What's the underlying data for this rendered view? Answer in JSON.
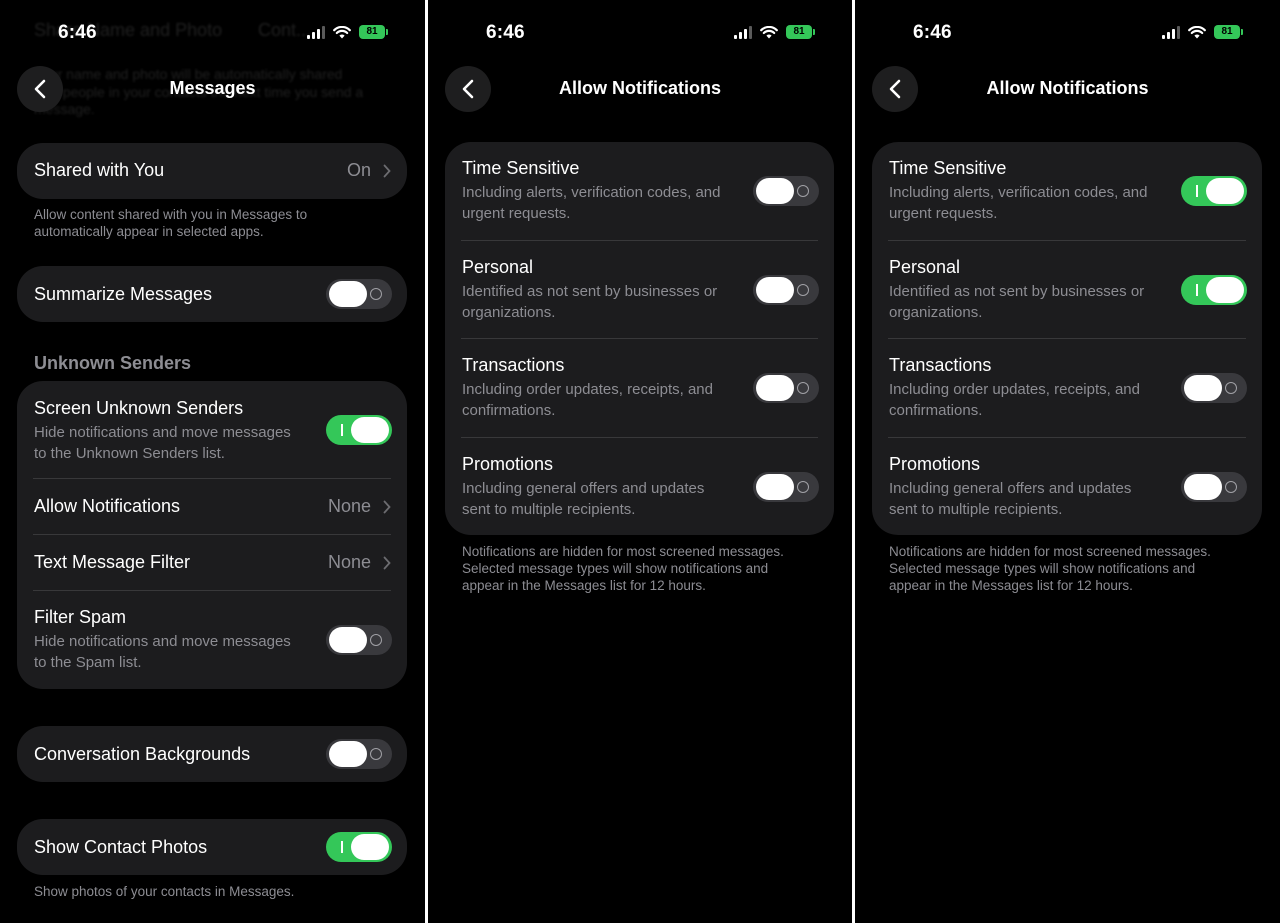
{
  "colors": {
    "accent_green": "#34c759",
    "card_bg": "#1c1c1e",
    "secondary_text": "#8d8d93"
  },
  "status_bar": {
    "time": "6:46",
    "battery": "81"
  },
  "screen1": {
    "title": "Messages",
    "ghost_header": "Share Name and Photo",
    "ghost_header_right": "Cont...",
    "ghost_lines": [
      "Your name and photo will be automatically shared",
      "with people in your contacts the next time you send a",
      "message."
    ],
    "shared_with_you": {
      "label": "Shared with You",
      "value": "On",
      "footnote_line1": "Allow content shared with you in Messages to",
      "footnote_line2": "automatically appear in selected apps."
    },
    "summarize": {
      "label": "Summarize Messages",
      "on": false
    },
    "unknown_section": "Unknown Senders",
    "screen_unknown": {
      "label": "Screen Unknown Senders",
      "sub1": "Hide notifications and move messages",
      "sub2": "to the Unknown Senders list.",
      "on": true
    },
    "allow_notifications": {
      "label": "Allow Notifications",
      "value": "None"
    },
    "text_filter": {
      "label": "Text Message Filter",
      "value": "None"
    },
    "filter_spam": {
      "label": "Filter Spam",
      "sub1": "Hide notifications and move messages",
      "sub2": "to the Spam list.",
      "on": false
    },
    "conversation_bg": {
      "label": "Conversation Backgrounds",
      "on": false
    },
    "contact_photos": {
      "label": "Show Contact Photos",
      "on": true,
      "footnote": "Show photos of your contacts in Messages."
    }
  },
  "notif_screen": {
    "title": "Allow Notifications",
    "items": [
      {
        "label": "Time Sensitive",
        "sub1": "Including alerts, verification codes, and",
        "sub2": "urgent requests."
      },
      {
        "label": "Personal",
        "sub1": "Identified as not sent by businesses or",
        "sub2": "organizations."
      },
      {
        "label": "Transactions",
        "sub1": "Including order updates, receipts, and",
        "sub2": "confirmations."
      },
      {
        "label": "Promotions",
        "sub1": "Including general offers and updates",
        "sub2": "sent to multiple recipients."
      }
    ],
    "footnote1": "Notifications are hidden for most screened messages.",
    "footnote2": "Selected message types will show notifications and",
    "footnote3": "appear in the Messages list for 12 hours."
  },
  "screen2_toggles": [
    false,
    false,
    false,
    false
  ],
  "screen3_toggles": [
    true,
    true,
    false,
    false
  ],
  "icons": {
    "back": "chevron-left-icon",
    "disclosure": "chevron-right-icon",
    "wifi": "wifi-icon",
    "signal": "cellular-signal-icon",
    "battery": "battery-icon"
  }
}
